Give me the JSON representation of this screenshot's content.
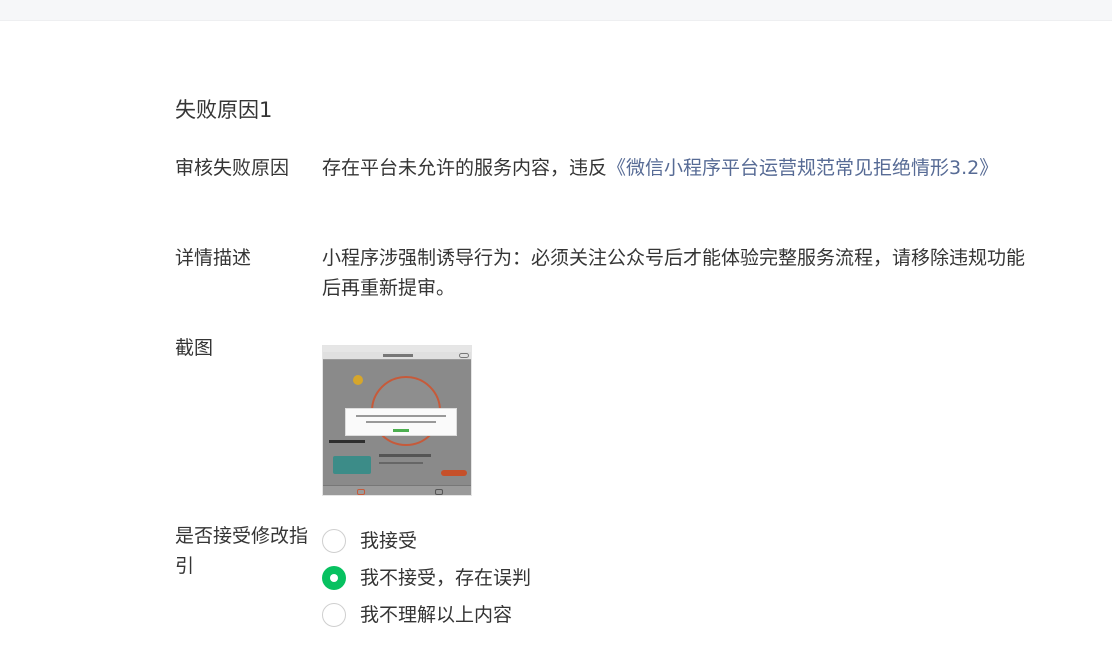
{
  "section": {
    "title": "失败原因1"
  },
  "reason": {
    "label": "审核失败原因",
    "text": "存在平台未允许的服务内容，违反",
    "link": "《微信小程序平台运营规范常见拒绝情形3.2》"
  },
  "detail": {
    "label": "详情描述",
    "text": "小程序涉强制诱导行为：必须关注公众号后才能体验完整服务流程，请移除违规功能后再重新提审。"
  },
  "screenshot": {
    "label": "截图"
  },
  "accept": {
    "label": "是否接受修改指引",
    "options": [
      {
        "label": "我接受",
        "checked": false
      },
      {
        "label": "我不接受，存在误判",
        "checked": true
      },
      {
        "label": "我不理解以上内容",
        "checked": false
      }
    ]
  },
  "colors": {
    "link": "#576b95",
    "accent": "#07c160",
    "text": "#353535"
  }
}
